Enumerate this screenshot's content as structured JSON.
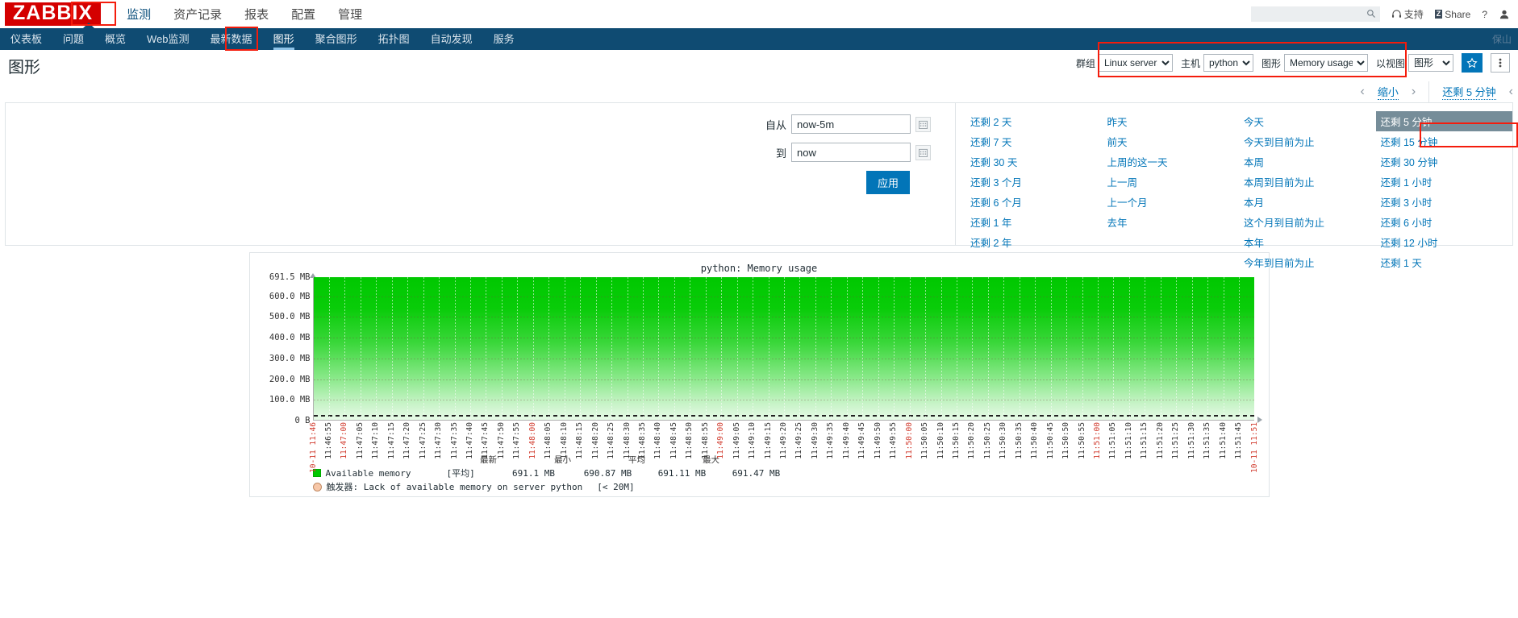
{
  "brand": {
    "logo": "ZABBIX",
    "color": "#d40000"
  },
  "main_menu": [
    {
      "label": "监测",
      "active": true,
      "highlighted": true
    },
    {
      "label": "资产记录",
      "active": false
    },
    {
      "label": "报表",
      "active": false
    },
    {
      "label": "配置",
      "active": false
    },
    {
      "label": "管理",
      "active": false
    }
  ],
  "top_right": {
    "search_placeholder": "",
    "search_value": "",
    "support_label": "支持",
    "share_label": "Share",
    "share_badge": "Z",
    "help_label": "?",
    "user_label": ""
  },
  "sub_menu": [
    {
      "label": "仪表板",
      "active": false
    },
    {
      "label": "问题",
      "active": false
    },
    {
      "label": "概览",
      "active": false
    },
    {
      "label": "Web监测",
      "active": false
    },
    {
      "label": "最新数据",
      "active": false
    },
    {
      "label": "图形",
      "active": true,
      "highlighted": true
    },
    {
      "label": "聚合图形",
      "active": false
    },
    {
      "label": "拓扑图",
      "active": false
    },
    {
      "label": "自动发现",
      "active": false
    },
    {
      "label": "服务",
      "active": false
    }
  ],
  "server_name": "保山",
  "page": {
    "title": "图形"
  },
  "filter": {
    "group_label": "群组",
    "group_value": "Linux servers",
    "host_label": "主机",
    "host_value": "python",
    "graph_label": "图形",
    "graph_value": "Memory usage",
    "view_label": "以视图",
    "view_value": "图形",
    "favorite_icon": "star-icon",
    "kebab_icon": "kebab-menu-icon"
  },
  "time_nav": {
    "prev": "‹",
    "zoom_out": "缩小",
    "next": "›",
    "selected_range": "还剩 5 分钟"
  },
  "time_panel": {
    "from_label": "自从",
    "from_value": "now-5m",
    "to_label": "到",
    "to_value": "now",
    "apply_label": "应用",
    "calendar_icon": "calendar-icon",
    "columns": [
      {
        "items": [
          {
            "label": "还剩 2 天"
          },
          {
            "label": "还剩 7 天"
          },
          {
            "label": "还剩 30 天"
          },
          {
            "label": "还剩 3 个月"
          },
          {
            "label": "还剩 6 个月"
          },
          {
            "label": "还剩 1 年"
          },
          {
            "label": "还剩 2 年"
          }
        ]
      },
      {
        "items": [
          {
            "label": "昨天"
          },
          {
            "label": "前天"
          },
          {
            "label": "上周的这一天"
          },
          {
            "label": "上一周"
          },
          {
            "label": "上一个月"
          },
          {
            "label": "去年"
          }
        ]
      },
      {
        "items": [
          {
            "label": "今天"
          },
          {
            "label": "今天到目前为止"
          },
          {
            "label": "本周"
          },
          {
            "label": "本周到目前为止"
          },
          {
            "label": "本月"
          },
          {
            "label": "这个月到目前为止"
          },
          {
            "label": "本年"
          },
          {
            "label": "今年到目前为止"
          }
        ]
      },
      {
        "items": [
          {
            "label": "还剩 5 分钟",
            "selected": true
          },
          {
            "label": "还剩 15 分钟"
          },
          {
            "label": "还剩 30 分钟"
          },
          {
            "label": "还剩 1 小时"
          },
          {
            "label": "还剩 3 小时"
          },
          {
            "label": "还剩 6 小时"
          },
          {
            "label": "还剩 12 小时"
          },
          {
            "label": "还剩 1 天"
          }
        ]
      }
    ]
  },
  "chart_data": {
    "type": "area",
    "title": "python: Memory usage",
    "xlabel": "",
    "ylabel": "",
    "ylim": [
      0,
      691.5
    ],
    "ytick_labels": [
      "691.5 MB",
      "600.0 MB",
      "500.0 MB",
      "400.0 MB",
      "300.0 MB",
      "200.0 MB",
      "100.0 MB",
      "0 B"
    ],
    "ytick_values": [
      691.5,
      600.0,
      500.0,
      400.0,
      300.0,
      200.0,
      100.0,
      0
    ],
    "grid": true,
    "legend_position": "bottom",
    "x_major_labels": [
      "10-11 11:46",
      "11:47:00",
      "11:48:00",
      "11:49:00",
      "11:50:00",
      "11:51:00",
      "10-11 11:51"
    ],
    "xtick_labels": [
      "10-11 11:46",
      "11:46:55",
      "11:47:00",
      "11:47:05",
      "11:47:10",
      "11:47:15",
      "11:47:20",
      "11:47:25",
      "11:47:30",
      "11:47:35",
      "11:47:40",
      "11:47:45",
      "11:47:50",
      "11:47:55",
      "11:48:00",
      "11:48:05",
      "11:48:10",
      "11:48:15",
      "11:48:20",
      "11:48:25",
      "11:48:30",
      "11:48:35",
      "11:48:40",
      "11:48:45",
      "11:48:50",
      "11:48:55",
      "11:49:00",
      "11:49:05",
      "11:49:10",
      "11:49:15",
      "11:49:20",
      "11:49:25",
      "11:49:30",
      "11:49:35",
      "11:49:40",
      "11:49:45",
      "11:49:50",
      "11:49:55",
      "11:50:00",
      "11:50:05",
      "11:50:10",
      "11:50:15",
      "11:50:20",
      "11:50:25",
      "11:50:30",
      "11:50:35",
      "11:50:40",
      "11:50:45",
      "11:50:50",
      "11:50:55",
      "11:51:00",
      "11:51:05",
      "11:51:10",
      "11:51:15",
      "11:51:20",
      "11:51:25",
      "11:51:30",
      "11:51:35",
      "11:51:40",
      "11:51:45",
      "10-11 11:51"
    ],
    "red_labels": [
      "10-11 11:46",
      "11:47:00",
      "11:48:00",
      "11:49:00",
      "11:50:00",
      "11:51:00",
      "10-11 11:51"
    ],
    "series": [
      {
        "name": "Available memory",
        "aggregation": "[平均]",
        "color": "#00c800",
        "last": "691.1 MB",
        "min": "690.87 MB",
        "avg": "691.11 MB",
        "max": "691.47 MB",
        "values": [
          691.1,
          691.2,
          691.47,
          691.1,
          690.9,
          691.1,
          691.2,
          691.0,
          691.1,
          691.3,
          691.1,
          690.87,
          691.1,
          691.2,
          691.1,
          691.0,
          691.1,
          691.2,
          691.1,
          691.1
        ]
      }
    ],
    "threshold": {
      "name": "触发器: Lack of available memory on server python",
      "condition": "[< 20M]",
      "color": "#f7c7a8",
      "value": 20
    },
    "legend_columns": [
      "最新",
      "最小",
      "平均",
      "最大"
    ]
  }
}
